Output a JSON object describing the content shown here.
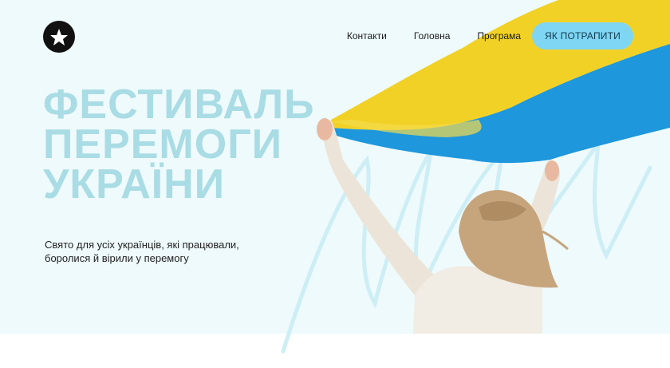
{
  "header": {
    "logo_icon": "star-in-circle-icon",
    "nav": [
      {
        "label": "Контакти"
      },
      {
        "label": "Головна"
      },
      {
        "label": "Програма"
      }
    ],
    "cta_label": "ЯК ПОТРАПИТИ"
  },
  "hero": {
    "title_lines": [
      "ФЕСТИВАЛЬ",
      "ПЕРЕМОГИ",
      "УКРАЇНИ"
    ],
    "subtitle_lines": [
      "Свято для усіх українців, які працювали,",
      "боролися й вірили у перемогу"
    ]
  },
  "colors": {
    "hero_bg": "#eefafc",
    "title": "#a9dce4",
    "cta_bg": "#7ed6f4",
    "flag_yellow": "#f2d126",
    "flag_blue": "#1e97dc"
  }
}
